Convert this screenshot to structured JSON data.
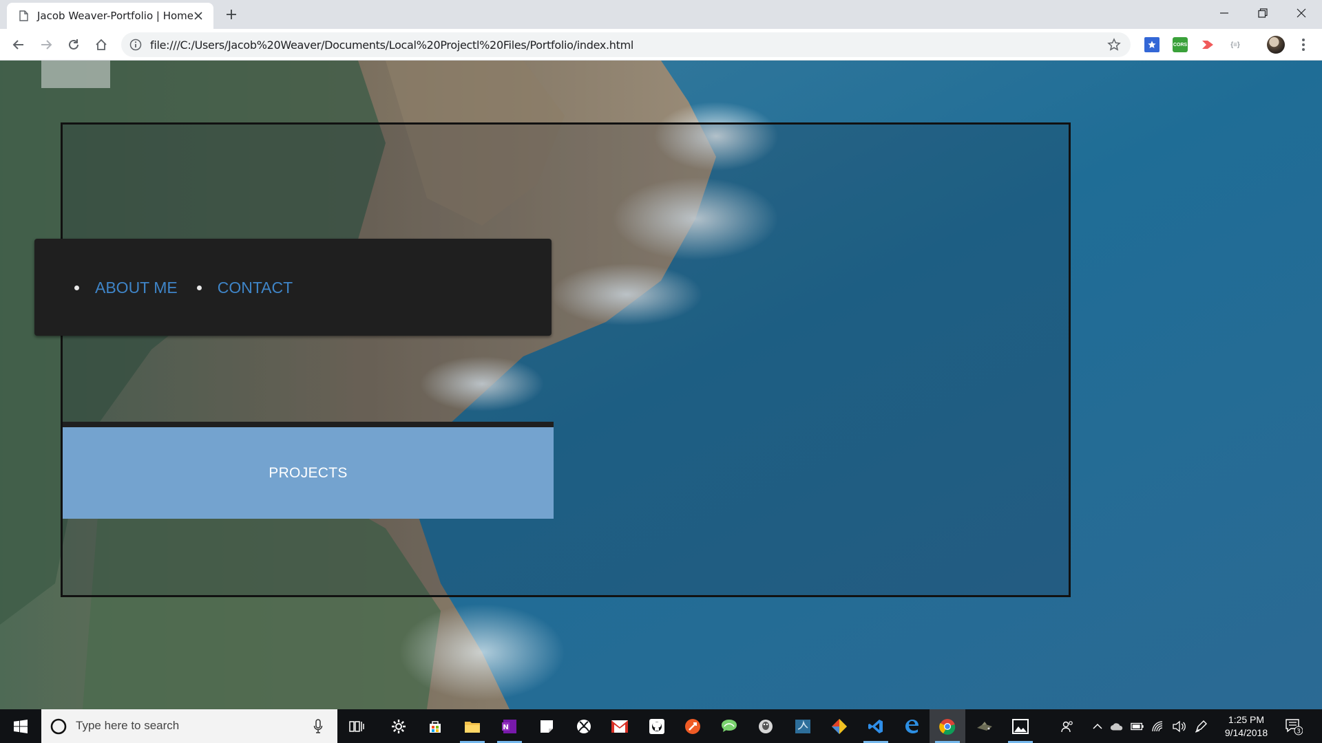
{
  "browser": {
    "tab_title": "Jacob Weaver-Portfolio | Home",
    "url": "file:///C:/Users/Jacob%20Weaver/Documents/Local%20Projectl%20Files/Portfolio/index.html",
    "extensions": [
      {
        "name": "bookmark-manager-icon",
        "color": "#3367d6"
      },
      {
        "name": "cors-extension-icon",
        "label": "CORS",
        "color": "#3aa13a"
      },
      {
        "name": "cast-extension-icon",
        "color": "#f05a5a"
      },
      {
        "name": "json-viewer-icon",
        "label": "{≡}",
        "color": "#9aa0a6"
      }
    ]
  },
  "page": {
    "nav_items": [
      {
        "label": "ABOUT ME"
      },
      {
        "label": "CONTACT"
      }
    ],
    "projects_label": "PROJECTS",
    "colors": {
      "nav_box": "#1f1f1f",
      "nav_link": "#3f85c8",
      "projects_box": "#74a3cf"
    }
  },
  "taskbar": {
    "search_placeholder": "Type here to search",
    "apps": [
      "task-view-icon",
      "settings-icon",
      "store-icon",
      "file-explorer-icon",
      "onenote-icon",
      "sticky-notes-icon",
      "xbox-icon",
      "gmail-icon",
      "github-icon",
      "postman-icon",
      "chat-icon",
      "database-icon",
      "mysql-workbench-icon",
      "git-icon",
      "vscode-icon",
      "edge-icon",
      "chrome-icon",
      "game-icon",
      "photos-icon"
    ],
    "time": "1:25 PM",
    "date": "9/14/2018",
    "notification_count": "3"
  }
}
